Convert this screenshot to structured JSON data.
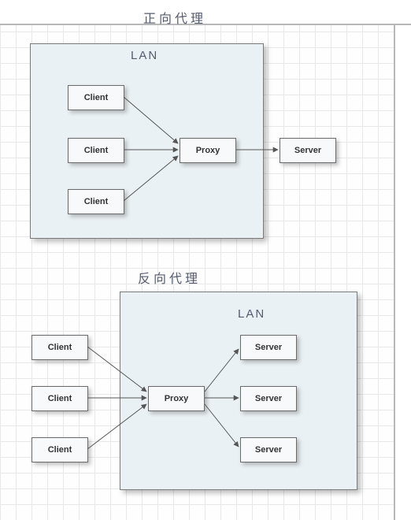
{
  "diagram1": {
    "title": "正向代理",
    "lan_label": "LAN",
    "nodes": {
      "client1": "Client",
      "client2": "Client",
      "client3": "Client",
      "proxy": "Proxy",
      "server": "Server"
    }
  },
  "diagram2": {
    "title": "反向代理",
    "lan_label": "LAN",
    "nodes": {
      "client1": "Client",
      "client2": "Client",
      "client3": "Client",
      "proxy": "Proxy",
      "server1": "Server",
      "server2": "Server",
      "server3": "Server"
    }
  }
}
